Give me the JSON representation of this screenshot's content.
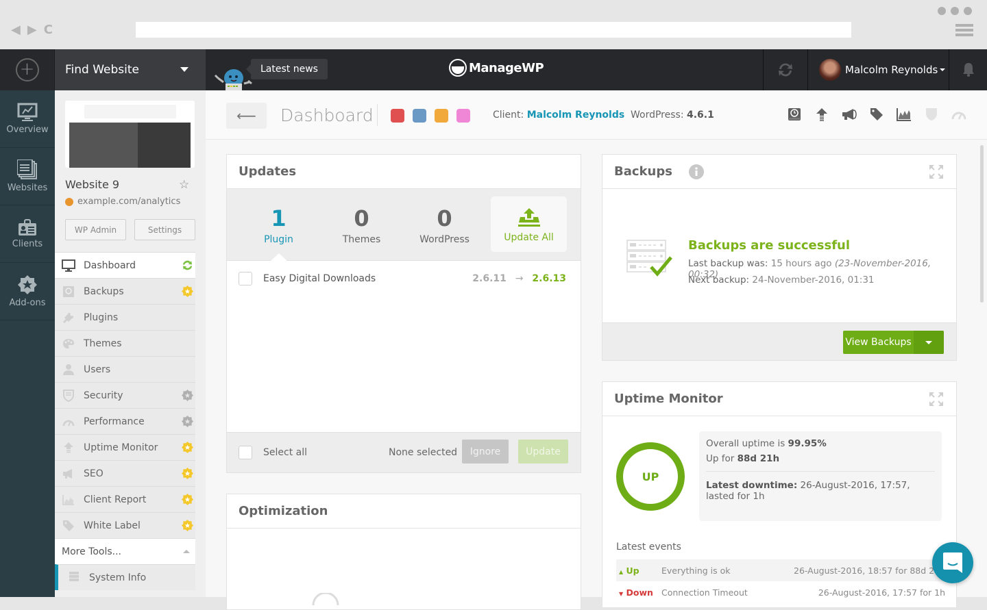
{
  "browser": {
    "url": ""
  },
  "topbar": {
    "find_website": "Find Website",
    "latest_news": "Latest news",
    "brand": "ManageWP",
    "user_name": "Malcolm Reynolds"
  },
  "leftnav": [
    {
      "label": "Overview",
      "icon": "overview-monitor-icon"
    },
    {
      "label": "Websites",
      "icon": "websites-stack-icon"
    },
    {
      "label": "Clients",
      "icon": "clients-badge-icon"
    },
    {
      "label": "Add-ons",
      "icon": "addons-star-icon"
    }
  ],
  "site": {
    "name": "Website 9",
    "url": "example.com/analytics",
    "wp_admin": "WP Admin",
    "settings": "Settings"
  },
  "site_menu": [
    {
      "label": "Dashboard",
      "icon": "monitor-icon",
      "badge": "sync",
      "active": true
    },
    {
      "label": "Backups",
      "icon": "backup-disk-icon",
      "badge": "premium-gold"
    },
    {
      "label": "Plugins",
      "icon": "plug-icon",
      "badge": ""
    },
    {
      "label": "Themes",
      "icon": "palette-icon",
      "badge": ""
    },
    {
      "label": "Users",
      "icon": "user-icon",
      "badge": ""
    },
    {
      "label": "Security",
      "icon": "shield-icon",
      "badge": "premium-gray"
    },
    {
      "label": "Performance",
      "icon": "gauge-icon",
      "badge": "premium-gray"
    },
    {
      "label": "Uptime Monitor",
      "icon": "arrow-up-icon",
      "badge": "premium-gold"
    },
    {
      "label": "SEO",
      "icon": "megaphone-icon",
      "badge": "premium-gold"
    },
    {
      "label": "Client Report",
      "icon": "chart-icon",
      "badge": "premium-gold"
    },
    {
      "label": "White Label",
      "icon": "tag-icon",
      "badge": "premium-gold"
    }
  ],
  "more_tools": "More Tools...",
  "system_info": "System Info",
  "header": {
    "title": "Dashboard",
    "tag_colors": [
      "#e05050",
      "#6a99c6",
      "#f0a93a",
      "#ef86d6"
    ],
    "client_label": "Client:",
    "client_name": "Malcolm Reynolds",
    "wp_label": "WordPress:",
    "wp_version": "4.6.1",
    "tools": [
      "backup-icon",
      "upload-arrow-icon",
      "megaphone-icon",
      "tag-icon",
      "chart-icon",
      "shield-icon",
      "gauge-icon"
    ]
  },
  "updates": {
    "title": "Updates",
    "tabs": [
      {
        "count": "1",
        "label": "Plugin"
      },
      {
        "count": "0",
        "label": "Themes"
      },
      {
        "count": "0",
        "label": "WordPress"
      }
    ],
    "update_all": "Update All",
    "items": [
      {
        "name": "Easy Digital Downloads",
        "from": "2.6.11",
        "to": "2.6.13"
      }
    ],
    "select_all": "Select all",
    "none_selected": "None selected",
    "ignore": "Ignore",
    "update": "Update"
  },
  "optimization": {
    "title": "Optimization"
  },
  "backups": {
    "title": "Backups",
    "status": "Backups are successful",
    "last_label": "Last backup was:",
    "last_value": "15 hours ago",
    "last_date": "(23-November-2016, 00:32)",
    "next_label": "Next backup:",
    "next_value": "24-November-2016, 01:31",
    "view_button": "View Backups"
  },
  "uptime": {
    "title": "Uptime Monitor",
    "status": "UP",
    "overall_label": "Overall uptime is",
    "overall_value": "99.95%",
    "upfor_label": "Up for",
    "upfor_value": "88d 21h",
    "downtime_label": "Latest downtime:",
    "downtime_value": "26-August-2016, 17:57, lasted for 1h",
    "events_title": "Latest events",
    "events": [
      {
        "status": "Up",
        "message": "Everything is ok",
        "when": "26-August-2016, 18:57 for 88d 21h"
      },
      {
        "status": "Down",
        "message": "Connection Timeout",
        "when": "26-August-2016, 17:57 for 1h"
      }
    ]
  }
}
